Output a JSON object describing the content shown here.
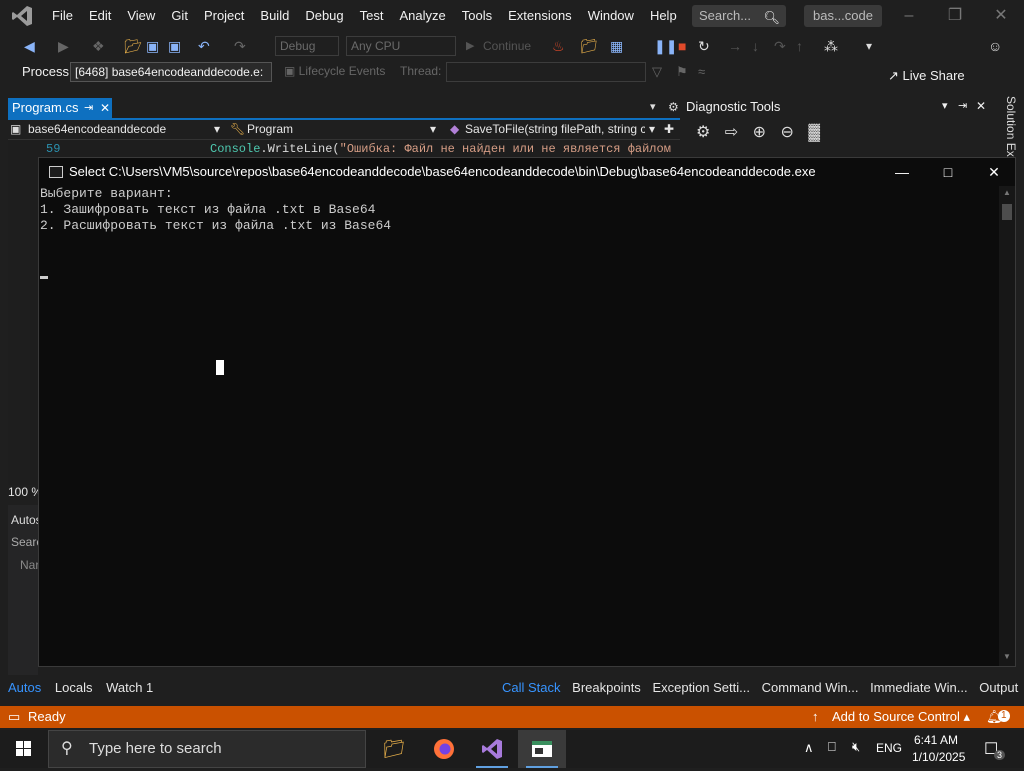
{
  "menubar": {
    "items": [
      "File",
      "Edit",
      "View",
      "Git",
      "Project",
      "Build",
      "Debug",
      "Test",
      "Analyze",
      "Tools",
      "Extensions",
      "Window",
      "Help"
    ],
    "search_placeholder": "Search...",
    "solution_name": "bas...code"
  },
  "toolbar": {
    "config": "Debug",
    "platform": "Any CPU",
    "continue_label": "Continue",
    "live_share": "Live Share"
  },
  "process_bar": {
    "label": "Process:",
    "process_value": "[6468] base64encodeanddecode.e:",
    "lifecycle_label": "Lifecycle Events",
    "thread_label": "Thread:"
  },
  "editor": {
    "tab_name": "Program.cs",
    "nav_project": "base64encodeanddecode",
    "nav_class": "Program",
    "nav_member": "SaveToFile(string filePath, string cc",
    "line_number": "59",
    "code_class": "Console",
    "code_plain": ".WriteLine(",
    "code_string": "\"Ошибка: Файл не найден или не является файлом",
    "zoom": "100 %"
  },
  "diagnostics": {
    "title": "Diagnostic Tools",
    "solution_explorer": "Solution Ex"
  },
  "panels": {
    "autos_fragment": "Autos",
    "search_fragment": "Searc",
    "name_fragment": "Nar",
    "left_tabs": [
      "Autos",
      "Locals",
      "Watch 1"
    ],
    "right_tabs": [
      "Call Stack",
      "Breakpoints",
      "Exception Setti...",
      "Command Win...",
      "Immediate Win...",
      "Output"
    ]
  },
  "statusbar": {
    "ready": "Ready",
    "add_source": "Add to Source Control",
    "notifications": "1"
  },
  "console": {
    "title": "Select C:\\Users\\VM5\\source\\repos\\base64encodeanddecode\\base64encodeanddecode\\bin\\Debug\\base64encodeanddecode.exe",
    "lines": [
      "Выберите вариант:",
      "1. Зашифровать текст из файла .txt в Base64",
      "2. Расшифровать текст из файла .txt из Base64"
    ]
  },
  "taskbar": {
    "search_placeholder": "Type here to search",
    "language": "ENG",
    "time": "6:41 AM",
    "date": "1/10/2025",
    "notification_count": "3"
  },
  "colors": {
    "accent": "#0e70c0",
    "statusbar": "#ca5100",
    "console_bg": "#0c0c0c"
  }
}
